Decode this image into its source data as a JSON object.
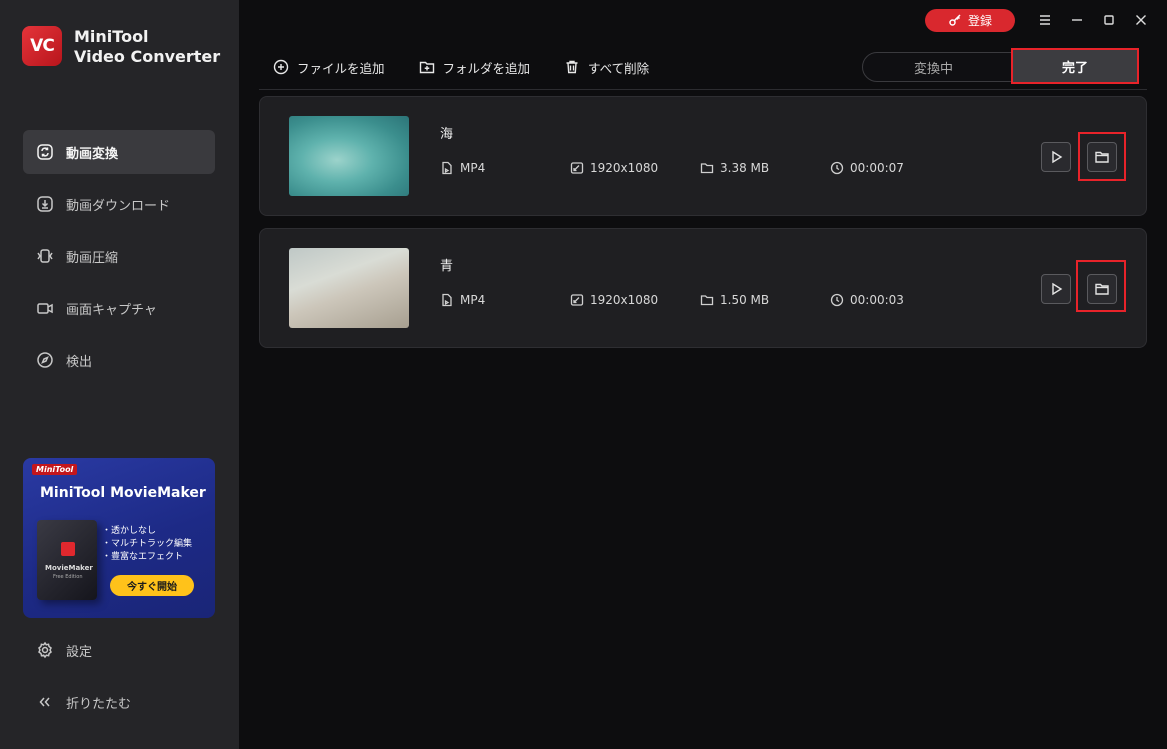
{
  "app": {
    "logo_text": "VC",
    "brand_line1": "MiniTool",
    "brand_line2": "Video Converter"
  },
  "sidebar": {
    "items": [
      {
        "label": "動画変換",
        "icon": "convert-icon",
        "active": true
      },
      {
        "label": "動画ダウンロード",
        "icon": "download-icon",
        "active": false
      },
      {
        "label": "動画圧縮",
        "icon": "compress-icon",
        "active": false
      },
      {
        "label": "画面キャプチャ",
        "icon": "camera-icon",
        "active": false
      },
      {
        "label": "検出",
        "icon": "compass-icon",
        "active": false
      }
    ],
    "promo": {
      "badge": "MiniTool",
      "title": "MiniTool MovieMaker",
      "box_label": "MovieMaker",
      "box_edition": "Free Edition",
      "features": [
        "・透かしなし",
        "・マルチトラック編集",
        "・豊富なエフェクト"
      ],
      "cta": "今すぐ開始"
    },
    "settings_label": "設定",
    "collapse_label": "折りたたむ"
  },
  "window": {
    "register_label": "登録"
  },
  "toolbar": {
    "add_file": "ファイルを追加",
    "add_folder": "フォルダを追加",
    "delete_all": "すべて削除"
  },
  "tabs": {
    "converting": "変換中",
    "completed": "完了"
  },
  "files": [
    {
      "title": "海",
      "format": "MP4",
      "resolution": "1920x1080",
      "size": "3.38 MB",
      "duration": "00:00:07"
    },
    {
      "title": "青",
      "format": "MP4",
      "resolution": "1920x1080",
      "size": "1.50 MB",
      "duration": "00:00:03"
    }
  ],
  "colors": {
    "accent": "#d9282e",
    "highlight": "#e8232a",
    "promo_button": "#ffc21a"
  }
}
